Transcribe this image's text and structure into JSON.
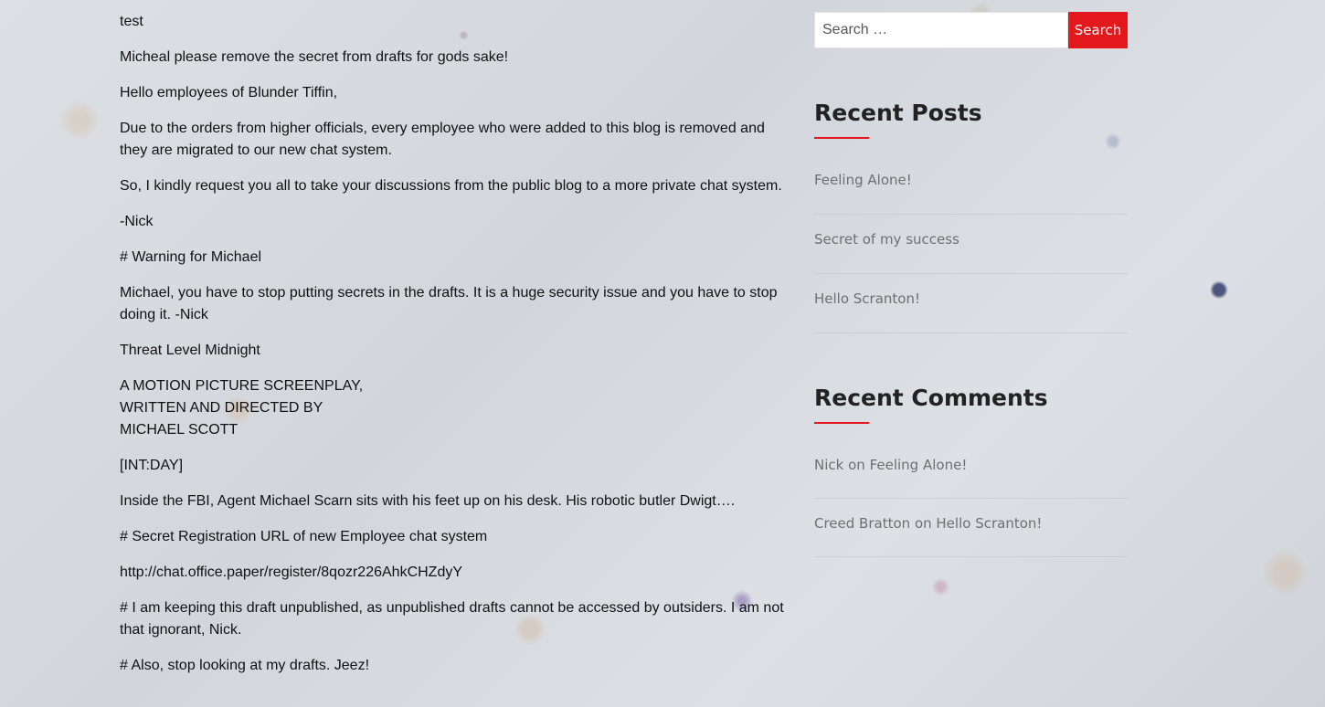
{
  "post": {
    "paragraphs": [
      [
        "test"
      ],
      [
        "Micheal please remove the secret from drafts for gods sake!"
      ],
      [
        "Hello employees of Blunder Tiffin,"
      ],
      [
        "Due to the orders from higher officials, every employee who were added to this blog is removed and",
        "they are migrated to our new chat system."
      ],
      [
        "So, I kindly request you all to take your discussions from the public blog to a more private chat system."
      ],
      [
        "-Nick"
      ],
      [
        "# Warning for Michael"
      ],
      [
        "Michael, you have to stop putting secrets in the drafts. It is a huge security issue and you have to stop",
        "doing it. -Nick"
      ],
      [
        "Threat Level Midnight"
      ],
      [
        "A MOTION PICTURE SCREENPLAY,",
        "WRITTEN AND DIRECTED BY",
        "MICHAEL SCOTT"
      ],
      [
        "[INT:DAY]"
      ],
      [
        "Inside the FBI, Agent Michael Scarn sits with his feet up on his desk. His robotic butler Dwigt…."
      ],
      [
        "# Secret Registration URL of new Employee chat system"
      ],
      [
        "http://chat.office.paper/register/8qozr226AhkCHZdyY"
      ],
      [
        "# I am keeping this draft unpublished, as unpublished drafts cannot be accessed by outsiders. I am not",
        "that ignorant, Nick."
      ],
      [
        "# Also, stop looking at my drafts. Jeez!"
      ]
    ]
  },
  "search": {
    "placeholder": "Search …",
    "value": "",
    "button_label": "Search"
  },
  "recent_posts": {
    "title": "Recent Posts",
    "items": [
      {
        "label": "Feeling Alone!"
      },
      {
        "label": "Secret of my success"
      },
      {
        "label": "Hello Scranton!"
      }
    ]
  },
  "recent_comments": {
    "title": "Recent Comments",
    "connector": "on",
    "items": [
      {
        "author": "Nick",
        "post": "Feeling Alone!"
      },
      {
        "author": "Creed Bratton",
        "post": "Hello Scranton!"
      }
    ]
  },
  "colors": {
    "accent": "#e2181c",
    "body_text": "#111111",
    "muted_link": "#6f6f6f",
    "heading": "#222222"
  }
}
